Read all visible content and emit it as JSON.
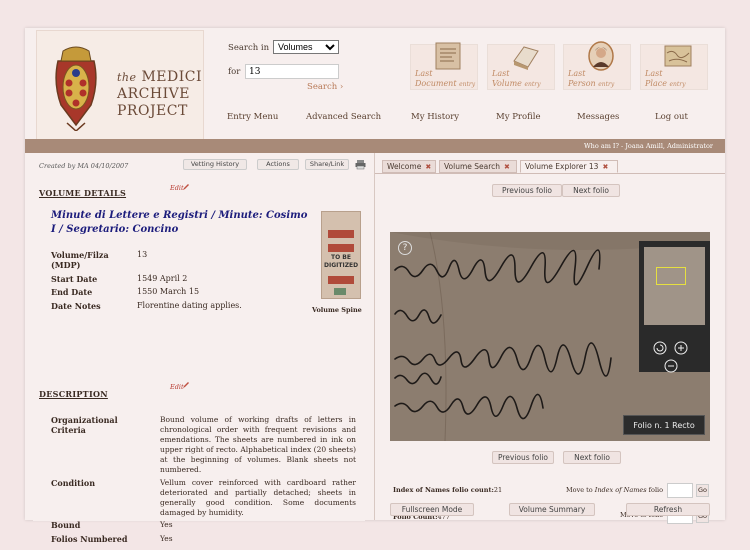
{
  "header": {
    "logo": {
      "the": "the",
      "line1": "MEDICI",
      "line2": "ARCHIVE",
      "line3": "PROJECT"
    },
    "search": {
      "label": "Search in",
      "scope": "Volumes",
      "for_label": "for",
      "query": "13",
      "go_label": "Search ›"
    },
    "quick_links": [
      {
        "line1": "Last",
        "line2": "Document",
        "suffix": "entry"
      },
      {
        "line1": "Last",
        "line2": "Volume",
        "suffix": "entry"
      },
      {
        "line1": "Last",
        "line2": "Person",
        "suffix": "entry"
      },
      {
        "line1": "Last",
        "line2": "Place",
        "suffix": "entry"
      }
    ],
    "nav": [
      "Entry Menu",
      "Advanced Search",
      "My History",
      "My Profile",
      "Messages",
      "Log out"
    ],
    "user": "Who am I? - Joana Amill, Administrator"
  },
  "left": {
    "created": "Created by MA 04/10/2007",
    "buttons": [
      "Vetting History",
      "Actions",
      "Share/Link"
    ],
    "volume_details": {
      "heading": "VOLUME DETAILS",
      "edit": "Edit",
      "title": "Minute di Lettere e Registri / Minute: Cosimo I / Segretario: Concino",
      "fields": [
        {
          "label": "Volume/Filza (MDP)",
          "value": "13"
        },
        {
          "label": "Start Date",
          "value": "1549 April 2"
        },
        {
          "label": "End Date",
          "value": "1550 March 15"
        },
        {
          "label": "Date Notes",
          "value": "Florentine dating applies."
        }
      ],
      "spine_text": "TO BE DIGITIZED",
      "spine_label": "Volume Spine"
    },
    "description": {
      "heading": "DESCRIPTION",
      "edit": "Edit",
      "fields": [
        {
          "label": "Organizational Criteria",
          "value": "Bound volume of working drafts of letters in chronological order with frequent revisions and emendations. The sheets are numbered in ink on upper right of recto. Alphabetical index (20 sheets) at the beginning of volumes. Blank sheets not numbered."
        },
        {
          "label": "Condition",
          "value": "Vellum cover reinforced with cardboard rather deteriorated and partially detached; sheets in generally good condition. Some documents damaged by humidity."
        },
        {
          "label": "Bound",
          "value": "Yes"
        },
        {
          "label": "Folios Numbered",
          "value": "Yes"
        }
      ]
    }
  },
  "right": {
    "tabs": [
      "Welcome",
      "Volume Search",
      "Volume Explorer 13"
    ],
    "prev_folio": "Previous folio",
    "next_folio": "Next folio",
    "folio_label": "Folio n. 1 Recto",
    "index_label": "Index of Names folio count:",
    "index_count": "21",
    "move_index_pre": "Move to",
    "move_index_em": "Index of Names",
    "move_index_post": "folio",
    "folio_count_label": "Folio Count:",
    "folio_count": "477",
    "move_folio": "Move to folio",
    "go": "Go",
    "buttons": [
      "Fullscreen Mode",
      "Volume Summary",
      "Refresh"
    ]
  }
}
